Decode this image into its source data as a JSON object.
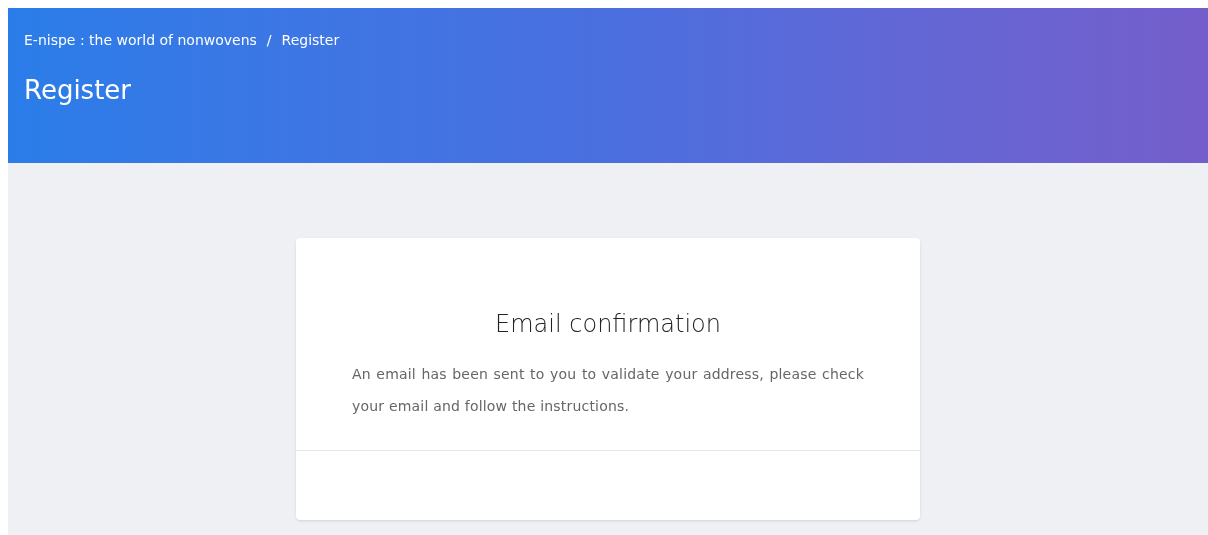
{
  "breadcrumb": [
    {
      "label": "E-nispe : the world of nonwovens"
    },
    {
      "label": "Register"
    }
  ],
  "breadcrumb_separator": "/",
  "page_title": "Register",
  "card": {
    "title": "Email confirmation",
    "message": "An email has been sent to you to validate your address, please check your email and follow the instructions."
  }
}
